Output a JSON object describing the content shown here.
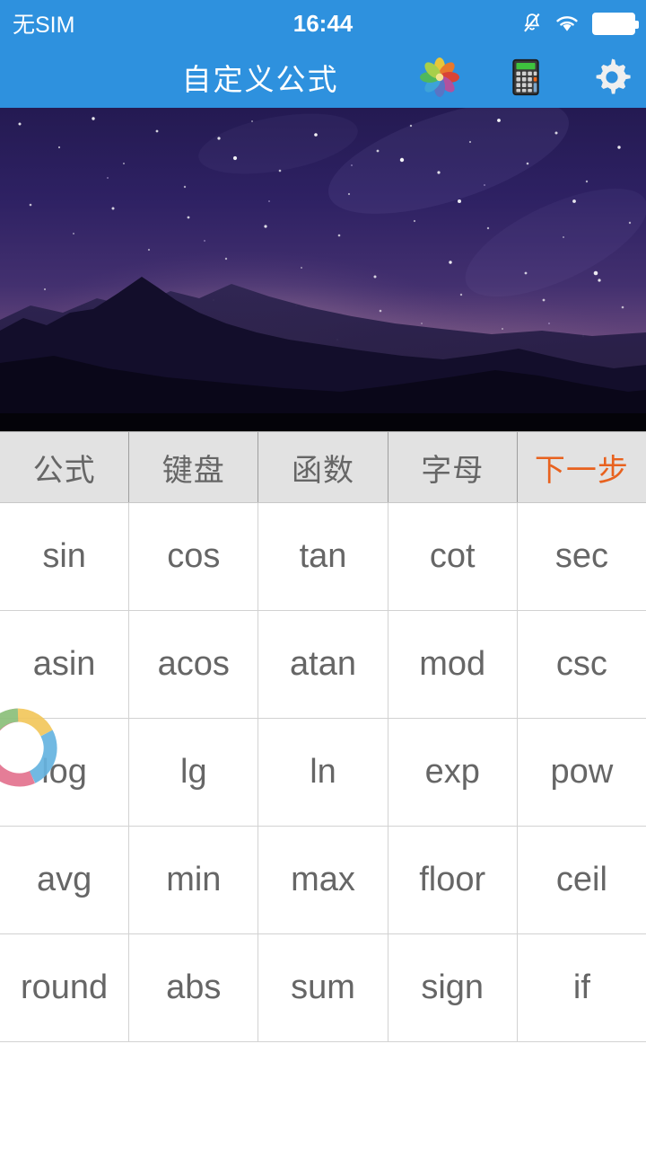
{
  "status_bar": {
    "carrier": "无SIM",
    "clock": "16:44",
    "icons": [
      "mute-bell-icon",
      "wifi-icon",
      "battery-icon"
    ],
    "background_color": "#2e91de",
    "text_color": "#ffffff"
  },
  "app_bar": {
    "title": "自定义公式",
    "background_color": "#2e91de",
    "actions": [
      {
        "name": "pinwheel-icon",
        "label": ""
      },
      {
        "name": "calculator-icon",
        "label": ""
      },
      {
        "name": "settings-gear-icon",
        "label": ""
      }
    ]
  },
  "banner": {
    "description": "starry night sky over mountain silhouette",
    "sky_top_color": "#2a1d5e",
    "sky_glow_color": "#f0d3c2",
    "mountain_color": "#120d28"
  },
  "tabs": {
    "accent_color": "#e8621f",
    "inactive_color": "#666666",
    "background_color": "#e2e2e2",
    "items": [
      {
        "label": "公式",
        "accent": false
      },
      {
        "label": "键盘",
        "accent": false
      },
      {
        "label": "函数",
        "accent": false
      },
      {
        "label": "字母",
        "accent": false
      },
      {
        "label": "下一步",
        "accent": true
      }
    ]
  },
  "function_grid": {
    "text_color": "#666666",
    "border_color": "#d2d2d2",
    "rows": [
      [
        "sin",
        "cos",
        "tan",
        "cot",
        "sec"
      ],
      [
        "asin",
        "acos",
        "atan",
        "mod",
        "csc"
      ],
      [
        "log",
        "lg",
        "ln",
        "exp",
        "pow"
      ],
      [
        "avg",
        "min",
        "max",
        "floor",
        "ceil"
      ],
      [
        "round",
        "abs",
        "sum",
        "sign",
        "if"
      ]
    ]
  },
  "floating_widget": {
    "name": "floating-ring-widget",
    "segment_colors": [
      "#e3738f",
      "#8cc07a",
      "#f2c75c",
      "#66b4e0"
    ]
  }
}
